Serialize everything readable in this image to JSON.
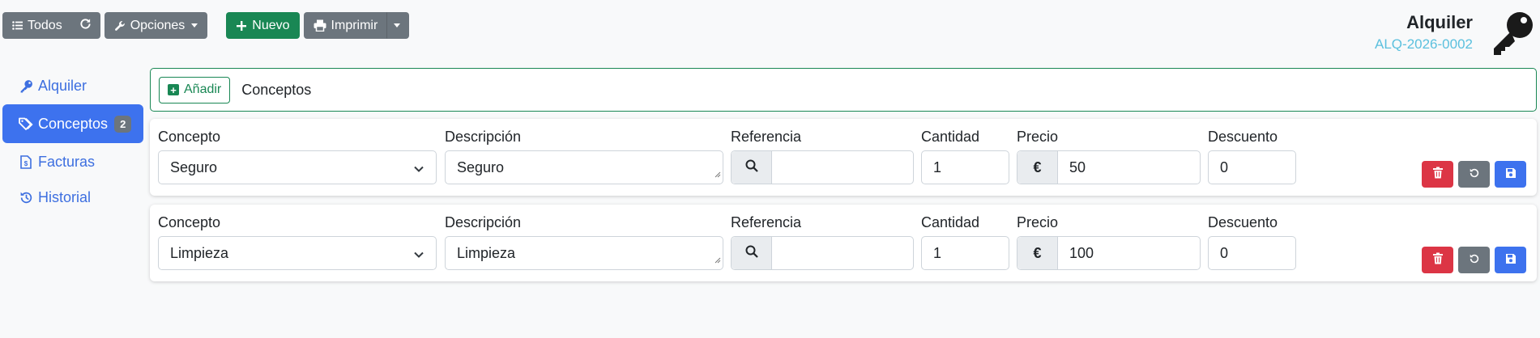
{
  "toolbar": {
    "todos_label": "Todos",
    "opciones_label": "Opciones",
    "nuevo_label": "Nuevo",
    "imprimir_label": "Imprimir"
  },
  "header": {
    "title": "Alquiler",
    "code": "ALQ-2026-0002"
  },
  "sidebar": {
    "items": [
      {
        "label": "Alquiler",
        "icon": "key-icon"
      },
      {
        "label": "Conceptos",
        "icon": "tags-icon",
        "badge": "2"
      },
      {
        "label": "Facturas",
        "icon": "invoice-icon"
      },
      {
        "label": "Historial",
        "icon": "history-icon"
      }
    ]
  },
  "section": {
    "add_label": "Añadir",
    "title": "Conceptos"
  },
  "labels": {
    "concepto": "Concepto",
    "descripcion": "Descripción",
    "referencia": "Referencia",
    "cantidad": "Cantidad",
    "precio": "Precio",
    "descuento": "Descuento",
    "currency": "€"
  },
  "rows": [
    {
      "concepto": "Seguro",
      "descripcion": "Seguro",
      "referencia": "",
      "cantidad": "1",
      "precio": "50",
      "descuento": "0"
    },
    {
      "concepto": "Limpieza",
      "descripcion": "Limpieza",
      "referencia": "",
      "cantidad": "1",
      "precio": "100",
      "descuento": "0"
    }
  ],
  "colors": {
    "primary": "#3d72ee",
    "success": "#198754",
    "danger": "#dc3545",
    "secondary": "#6c757d",
    "info": "#5bc0de"
  }
}
